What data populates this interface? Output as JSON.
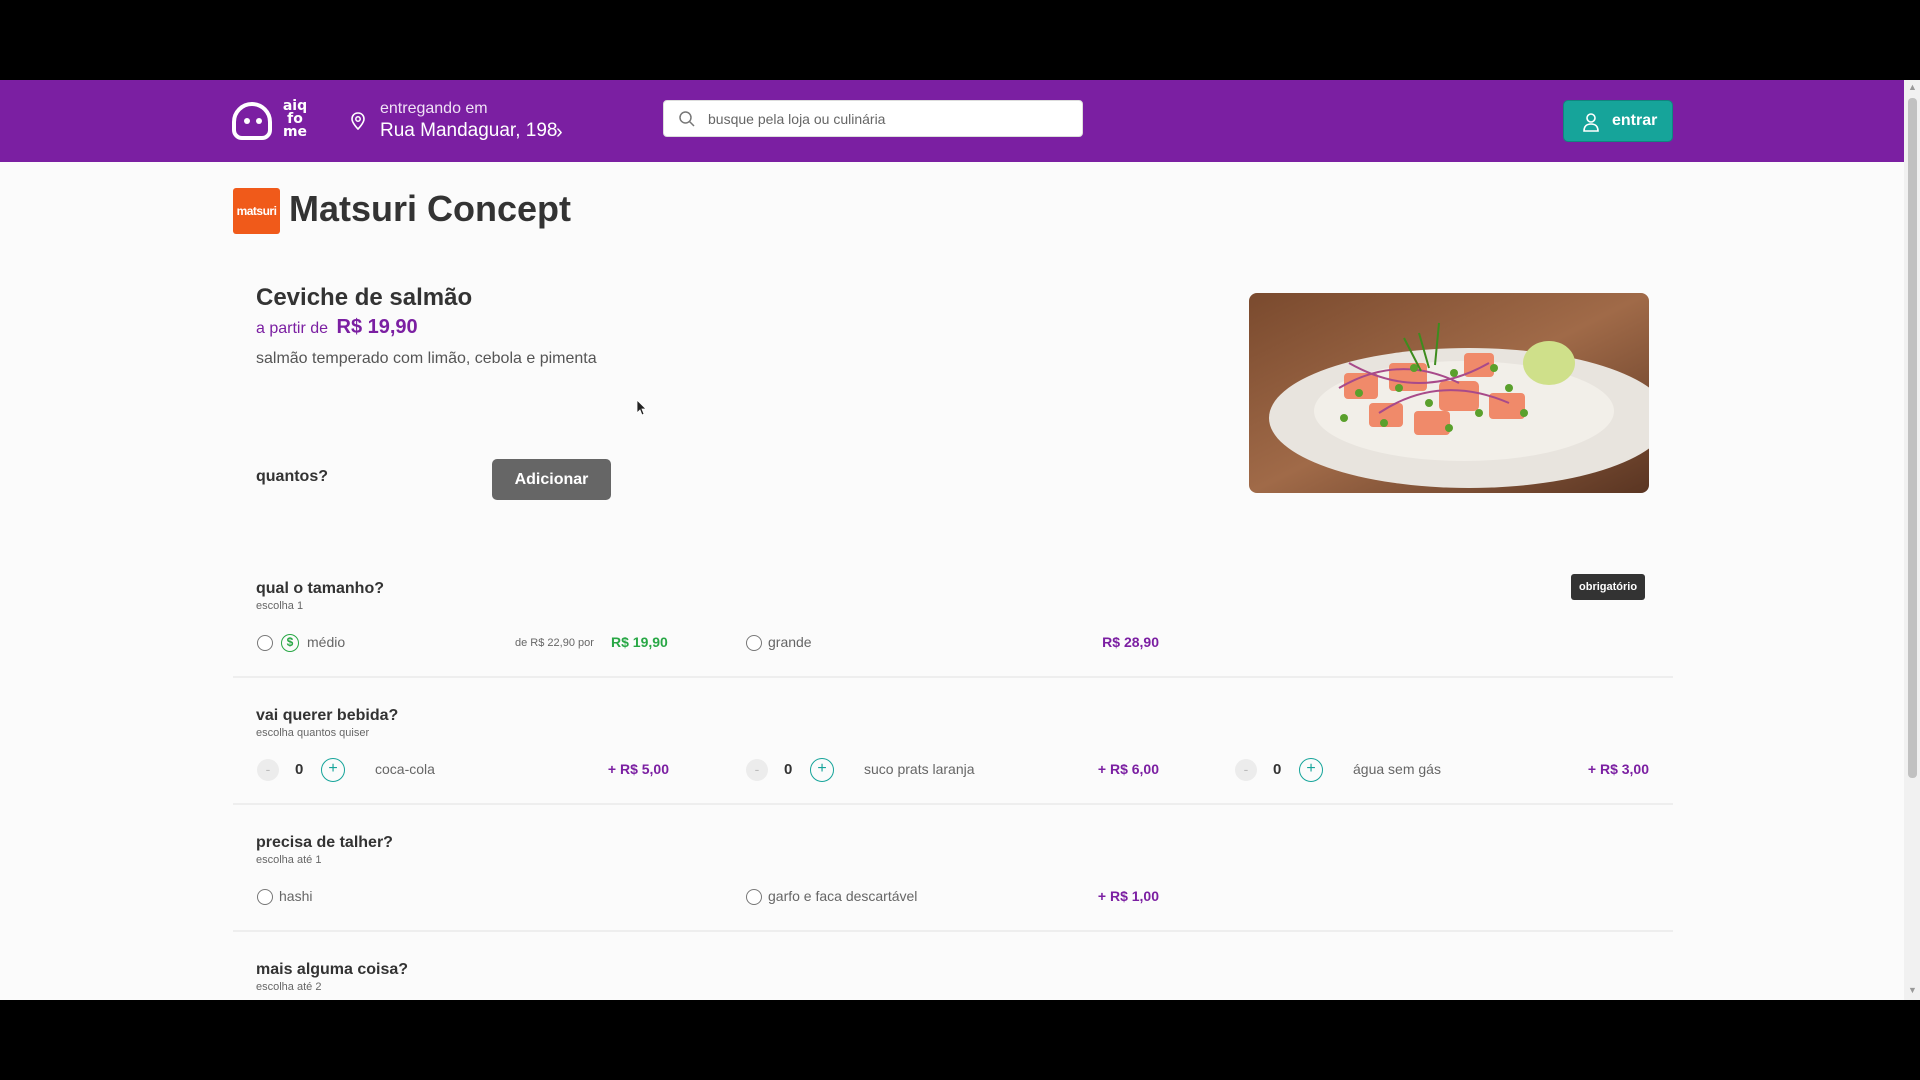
{
  "header": {
    "logo_text": "aiq\nfo\nme",
    "delivery_label": "entregando em",
    "delivery_address": "Rua Mandaguar, 198",
    "search_placeholder": "busque pela loja ou culinária",
    "login_label": "entrar",
    "colors": {
      "brand": "#7b1fa2",
      "accent": "#16a49a"
    }
  },
  "store": {
    "logo_text": "matsuri",
    "name": "Matsuri Concept"
  },
  "product": {
    "title": "Ceviche de salmão",
    "price_prefix": "a partir de",
    "price": "R$ 19,90",
    "description": "salmão temperado com limão, cebola e pimenta",
    "qty_label": "quantos?",
    "add_button": "Adicionar",
    "image": "salmon-ceviche-plate"
  },
  "groups": [
    {
      "title": "qual o tamanho?",
      "subtitle": "escolha 1",
      "badge": "obrigatório",
      "options": [
        {
          "label": "médio",
          "old_price": "de R$ 22,90 por",
          "price": "R$ 19,90",
          "promo_icon": "dollar-icon"
        },
        {
          "label": "grande",
          "price": "R$ 28,90"
        }
      ]
    },
    {
      "title": "vai querer bebida?",
      "subtitle": "escolha quantos quiser",
      "options": [
        {
          "label": "coca-cola",
          "qty": "0",
          "price": "+ R$ 5,00"
        },
        {
          "label": "suco prats laranja",
          "qty": "0",
          "price": "+ R$ 6,00"
        },
        {
          "label": "água sem gás",
          "qty": "0",
          "price": "+ R$ 3,00"
        }
      ]
    },
    {
      "title": "precisa de talher?",
      "subtitle": "escolha até 1",
      "options": [
        {
          "label": "hashi"
        },
        {
          "label": "garfo e faca descartável",
          "price": "+ R$ 1,00"
        }
      ]
    },
    {
      "title": "mais alguma coisa?",
      "subtitle": "escolha até 2"
    }
  ],
  "stepper": {
    "minus": "-",
    "plus": "+"
  }
}
